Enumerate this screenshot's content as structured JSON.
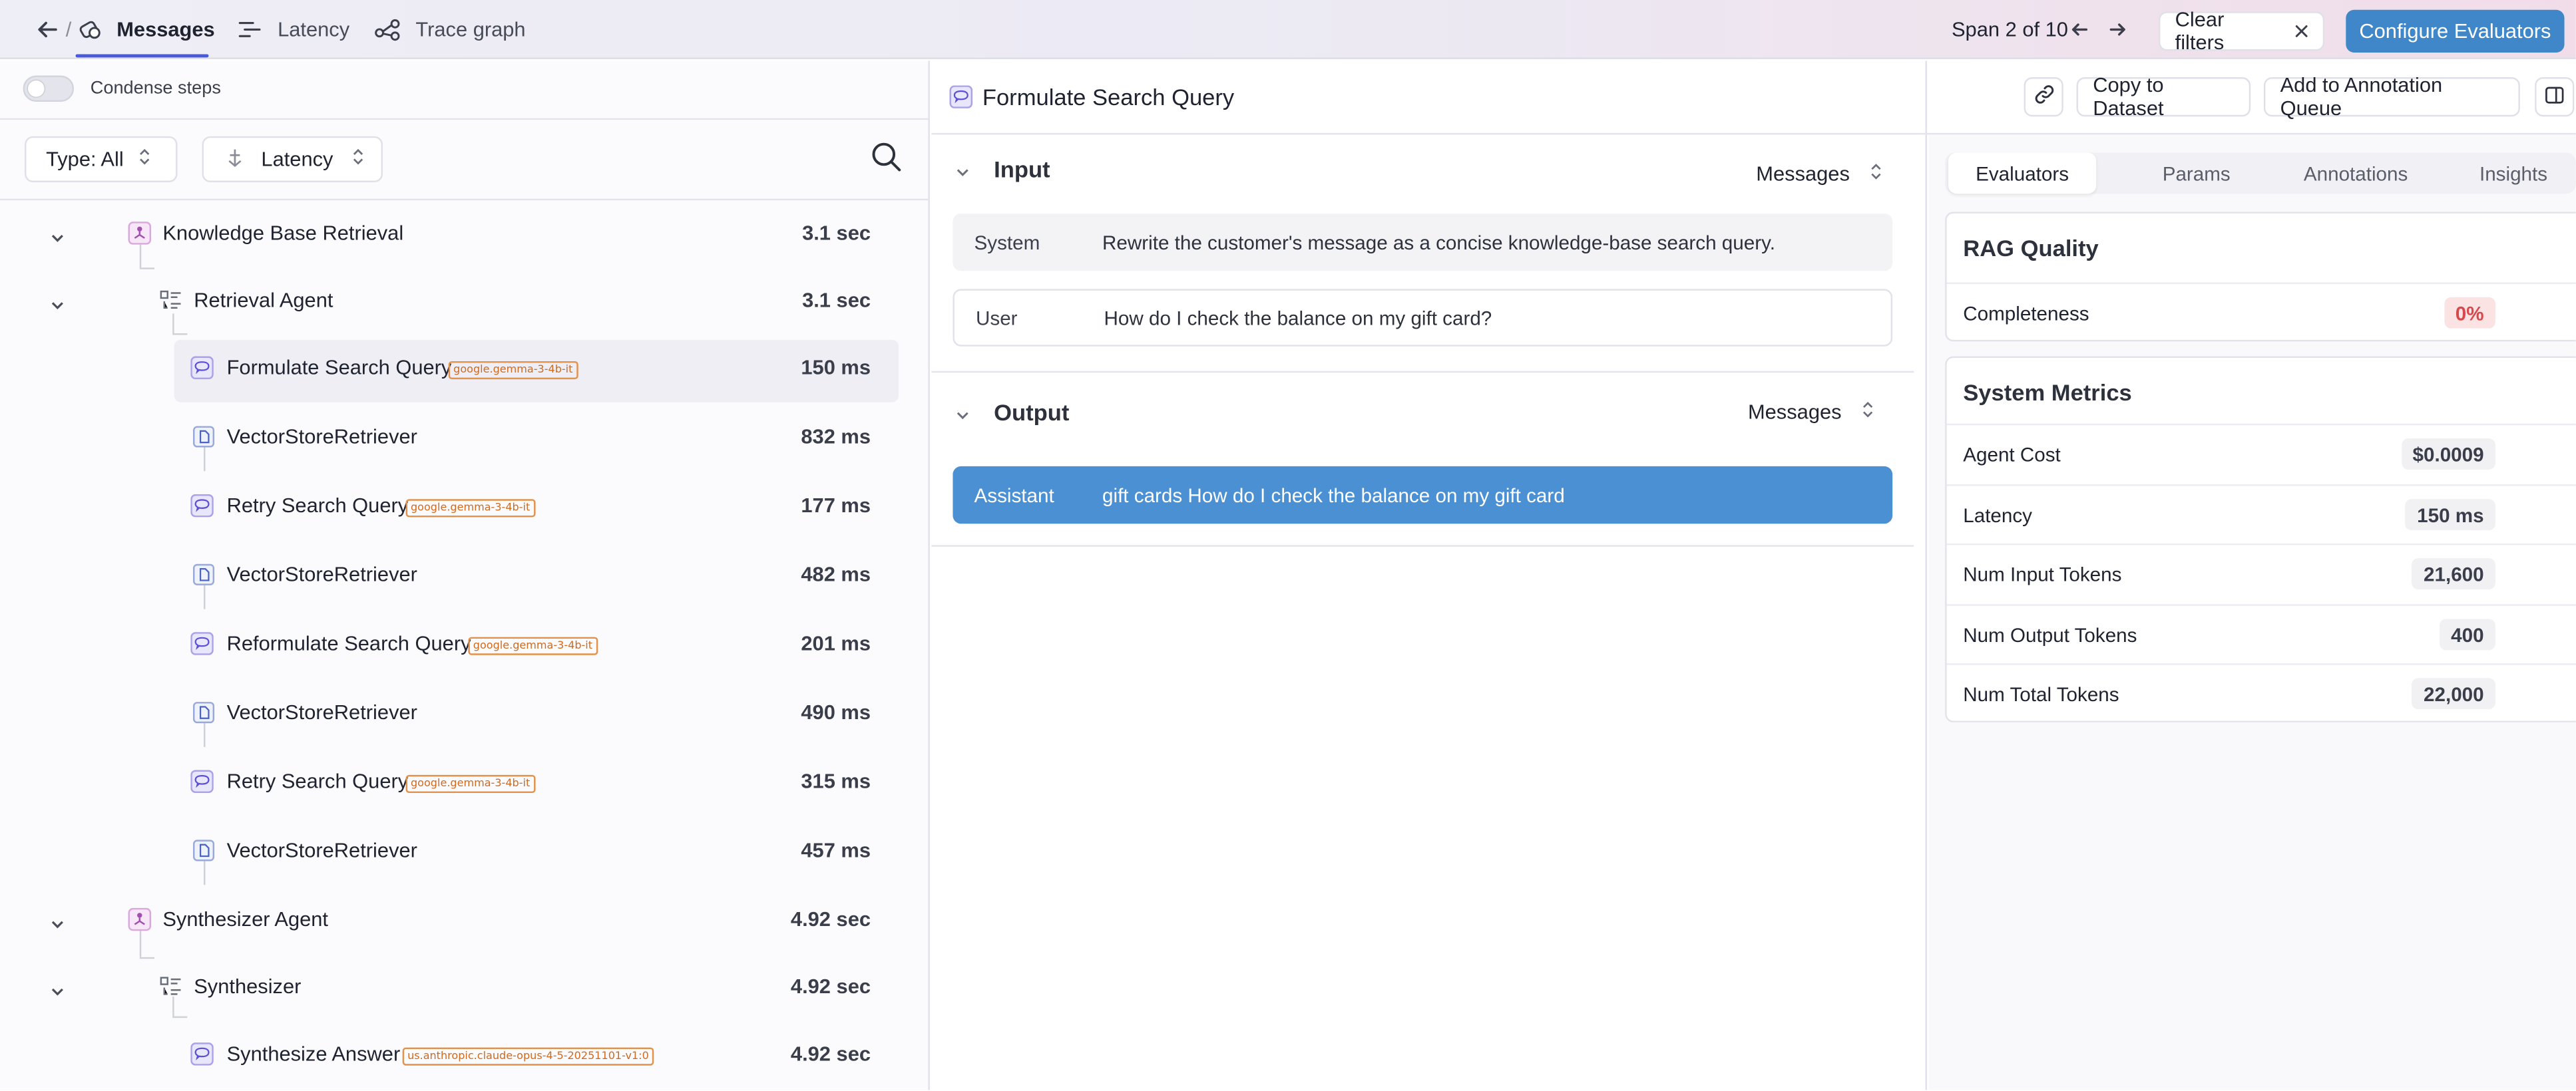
{
  "topbar": {
    "separator": "/",
    "tabs": [
      {
        "label": "Messages",
        "icon": "messages-icon",
        "active": true
      },
      {
        "label": "Latency",
        "icon": "latency-icon",
        "active": false
      },
      {
        "label": "Trace graph",
        "icon": "trace-graph-icon",
        "active": false
      }
    ],
    "span_counter": "Span 2 of 10",
    "clear_filters": "Clear filters",
    "configure_evaluators": "Configure Evaluators"
  },
  "left": {
    "condense_label": "Condense steps",
    "condense_on": false,
    "type_filter": "Type: All",
    "sort_select": "Latency",
    "tree": [
      {
        "label": "Knowledge Base Retrieval",
        "duration": "3.1 sec",
        "icon": "agent-icon",
        "level": 0,
        "collapsible": true
      },
      {
        "label": "Retrieval Agent",
        "duration": "3.1 sec",
        "icon": "chain-icon",
        "level": 1,
        "collapsible": true
      },
      {
        "label": "Formulate Search Query",
        "duration": "150 ms",
        "icon": "llm-icon",
        "level": 2,
        "badge": "google.gemma-3-4b-it",
        "selected": true
      },
      {
        "label": "VectorStoreRetriever",
        "duration": "832 ms",
        "icon": "retriever-icon",
        "level": 2
      },
      {
        "label": "Retry Search Query",
        "duration": "177 ms",
        "icon": "llm-icon",
        "level": 2,
        "badge": "google.gemma-3-4b-it"
      },
      {
        "label": "VectorStoreRetriever",
        "duration": "482 ms",
        "icon": "retriever-icon",
        "level": 2
      },
      {
        "label": "Reformulate Search Query",
        "duration": "201 ms",
        "icon": "llm-icon",
        "level": 2,
        "badge": "google.gemma-3-4b-it"
      },
      {
        "label": "VectorStoreRetriever",
        "duration": "490 ms",
        "icon": "retriever-icon",
        "level": 2
      },
      {
        "label": "Retry Search Query",
        "duration": "315 ms",
        "icon": "llm-icon",
        "level": 2,
        "badge": "google.gemma-3-4b-it"
      },
      {
        "label": "VectorStoreRetriever",
        "duration": "457 ms",
        "icon": "retriever-icon",
        "level": 2
      },
      {
        "label": "Synthesizer Agent",
        "duration": "4.92 sec",
        "icon": "agent-icon",
        "level": 0,
        "collapsible": true
      },
      {
        "label": "Synthesizer",
        "duration": "4.92 sec",
        "icon": "chain-icon",
        "level": 1,
        "collapsible": true
      },
      {
        "label": "Synthesize Answer",
        "duration": "4.92 sec",
        "icon": "llm-icon",
        "level": 2,
        "badge": "us.anthropic.claude-opus-4-5-20251101-v1:0"
      }
    ]
  },
  "middle": {
    "span_title": "Formulate Search Query",
    "copy_to_dataset": "Copy to Dataset",
    "add_to_annotation_queue": "Add to Annotation Queue",
    "input": {
      "title": "Input",
      "view": "Messages",
      "messages": [
        {
          "role": "System",
          "text": "Rewrite the customer's message as a concise knowledge-base search query."
        },
        {
          "role": "User",
          "text": "How do I check the balance on my gift card?"
        }
      ]
    },
    "output": {
      "title": "Output",
      "view": "Messages",
      "messages": [
        {
          "role": "Assistant",
          "text": "gift cards How do I check the balance on my gift card"
        }
      ]
    }
  },
  "right": {
    "tabs": [
      "Evaluators",
      "Params",
      "Annotations",
      "Insights"
    ],
    "active_tab": "Evaluators",
    "rag": {
      "title": "RAG Quality",
      "metrics": [
        {
          "label": "Completeness",
          "value": "0%"
        }
      ]
    },
    "system": {
      "title": "System Metrics",
      "metrics": [
        {
          "label": "Agent Cost",
          "value": "$0.0009"
        },
        {
          "label": "Latency",
          "value": "150 ms"
        },
        {
          "label": "Num Input Tokens",
          "value": "21,600"
        },
        {
          "label": "Num Output Tokens",
          "value": "400"
        },
        {
          "label": "Num Total Tokens",
          "value": "22,000"
        }
      ]
    }
  },
  "colors": {
    "accent": "#4a59d8",
    "primary_button": "#3f87c8",
    "assistant_bubble": "#4a90d3",
    "badge_orange": "#d06a1f",
    "bad_value": "#d9484d"
  }
}
